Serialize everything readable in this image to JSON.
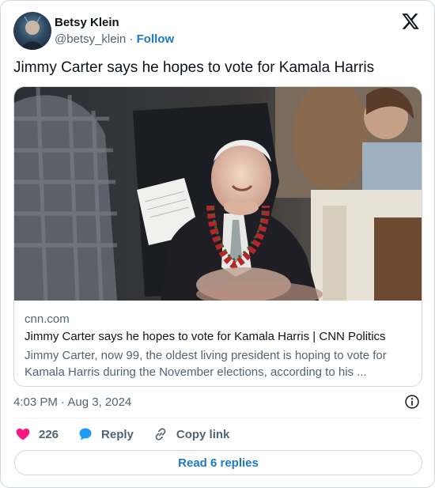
{
  "author": {
    "name": "Betsy Klein",
    "handle": "@betsy_klein",
    "separator": "·",
    "follow_label": "Follow"
  },
  "tweet": {
    "text": "Jimmy Carter says he hopes to vote for Kamala Harris",
    "timestamp": "4:03 PM · Aug 3, 2024"
  },
  "card": {
    "domain": "cnn.com",
    "title": "Jimmy Carter says he hopes to vote for Kamala Harris | CNN Politics",
    "description": "Jimmy Carter, now 99, the oldest living president is hoping to vote for Kamala Harris during the November elections, according to his ..."
  },
  "actions": {
    "likes_count": "226",
    "reply_label": "Reply",
    "copy_link_label": "Copy link"
  },
  "read_replies_label": "Read 6 replies",
  "icons": {
    "logo": "x-logo-icon",
    "info": "info-icon",
    "like": "heart-icon",
    "reply": "speech-bubble-icon",
    "copy": "link-icon"
  },
  "colors": {
    "link_blue": "#1d78c1",
    "heart": "#f91880",
    "reply_blue": "#1d9bf0",
    "secondary_text": "#536471",
    "border": "#cfd9de"
  }
}
